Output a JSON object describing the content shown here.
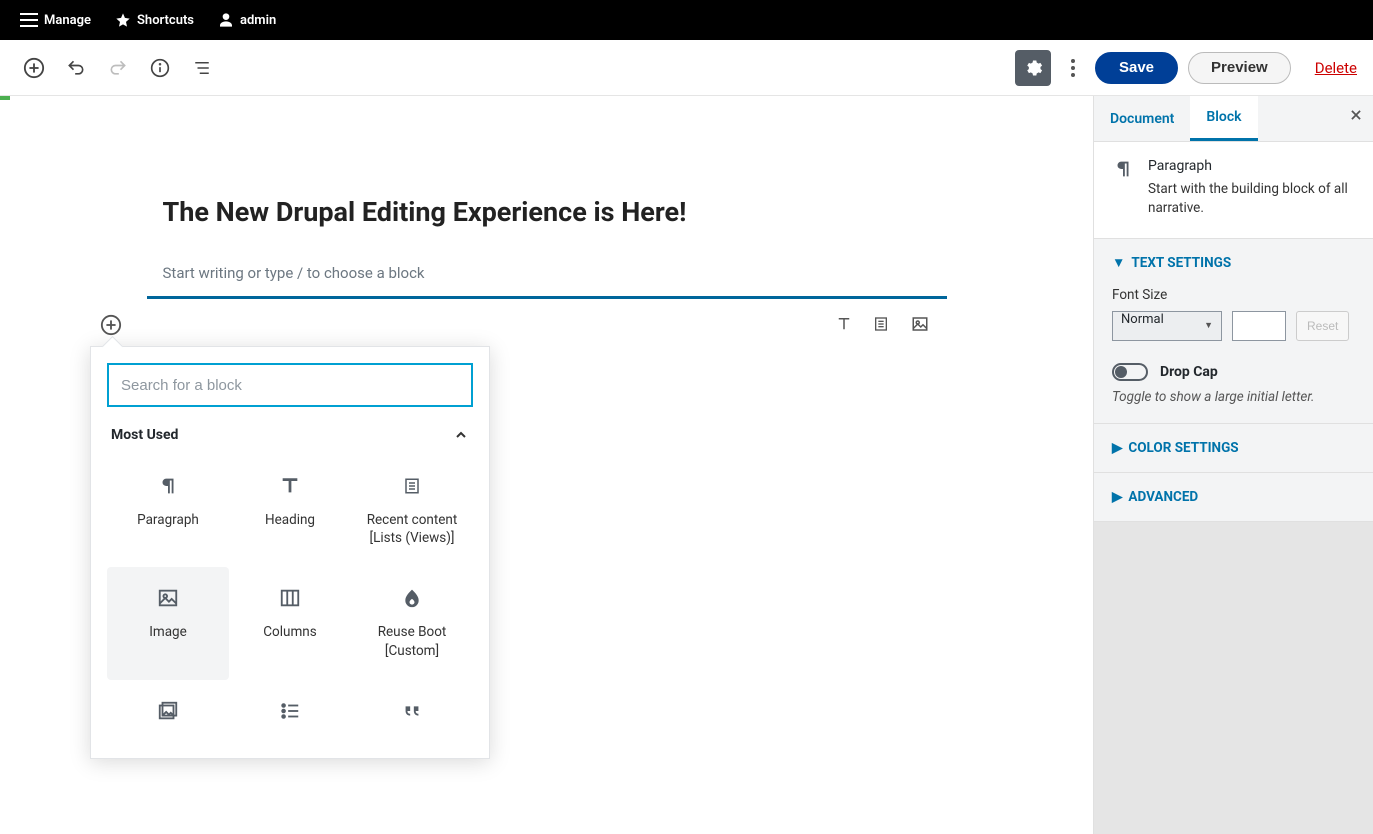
{
  "adminBar": {
    "manage": "Manage",
    "shortcuts": "Shortcuts",
    "user": "admin"
  },
  "toolbar": {
    "save": "Save",
    "preview": "Preview",
    "delete": "Delete"
  },
  "post": {
    "title": "The New Drupal Editing Experience is Here!",
    "paragraphPlaceholder": "Start writing or type / to choose a block"
  },
  "inserter": {
    "searchPlaceholder": "Search for a block",
    "sectionTitle": "Most Used",
    "blocks": {
      "paragraph": "Paragraph",
      "heading": "Heading",
      "recent": "Recent content [Lists (Views)]",
      "image": "Image",
      "columns": "Columns",
      "reuse": "Reuse Boot [Custom]"
    }
  },
  "sidebar": {
    "tabs": {
      "document": "Document",
      "block": "Block"
    },
    "blockMeta": {
      "title": "Paragraph",
      "desc": "Start with the building block of all narrative."
    },
    "textSettings": {
      "header": "TEXT SETTINGS",
      "fontSizeLabel": "Font Size",
      "fontSizeValue": "Normal",
      "reset": "Reset",
      "dropCap": "Drop Cap",
      "dropHint": "Toggle to show a large initial letter."
    },
    "colorSettings": "COLOR SETTINGS",
    "advanced": "ADVANCED"
  }
}
